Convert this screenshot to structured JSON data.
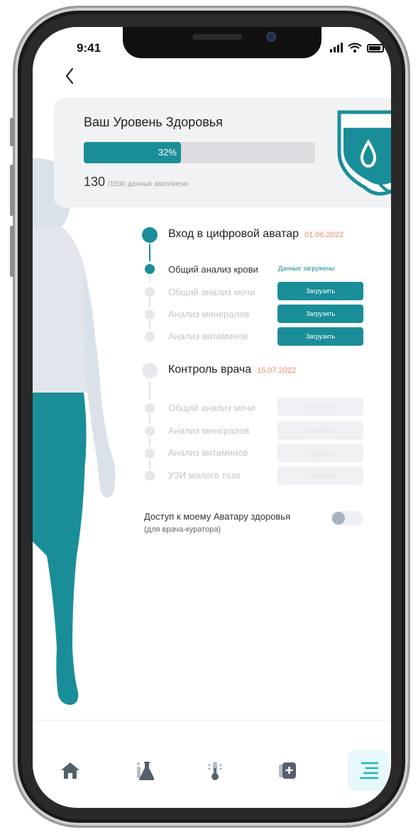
{
  "status": {
    "time": "9:41"
  },
  "health": {
    "title": "Ваш Уровень Здоровья",
    "percent_label": "32%",
    "percent": 32,
    "filled": "130",
    "filled_rest": "/1590 данных заполнено"
  },
  "stage1": {
    "title": "Вход в цифровой аватар",
    "date": "01.06.2022",
    "items": [
      {
        "label": "Общий анализ крови",
        "status": "Данные загружены"
      },
      {
        "label": "Общий анализ мочи",
        "button": "Загрузить"
      },
      {
        "label": "Анализ минералов",
        "button": "Загрузить"
      },
      {
        "label": "Анализ витаминов",
        "button": "Загрузить"
      }
    ]
  },
  "stage2": {
    "title": "Контроль врача",
    "date": "15.07.2022",
    "items": [
      {
        "label": "Общий анализ мочи",
        "button": "Загрузить"
      },
      {
        "label": "Анализ минералов",
        "button": "Загрузить"
      },
      {
        "label": "Анализ витаминов",
        "button": "Загрузить"
      },
      {
        "label": "УЗИ малого таза",
        "button": "Загрузить"
      }
    ]
  },
  "access": {
    "title": "Доступ к моему Аватару здоровья",
    "subtitle": "(для врача-куратора)",
    "enabled": false
  },
  "colors": {
    "teal": "#1a8e98",
    "date": "#f08a68",
    "inactive": "#c2c6cc"
  },
  "tabs": [
    {
      "icon": "home-icon",
      "active": false
    },
    {
      "icon": "lab-flask-icon",
      "active": false
    },
    {
      "icon": "thermometer-icon",
      "active": false
    },
    {
      "icon": "medical-card-icon",
      "active": false
    },
    {
      "icon": "menu-icon",
      "active": true
    }
  ]
}
